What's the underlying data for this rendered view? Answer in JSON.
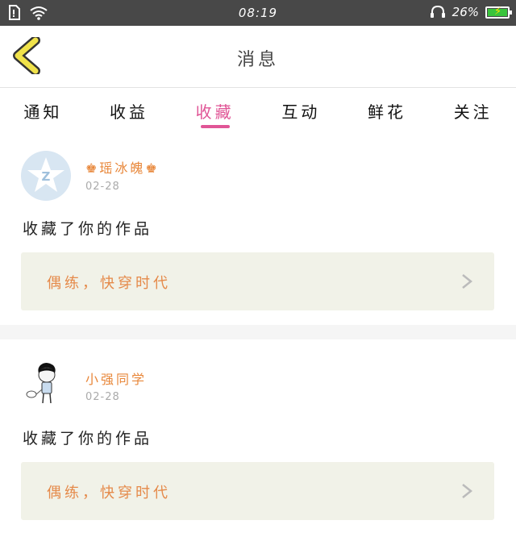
{
  "status_bar": {
    "time": "08:19",
    "battery_percent": "26%",
    "battery_level": 0.26
  },
  "header": {
    "title": "消息",
    "back_icon": "chevron-left-icon"
  },
  "tabs": [
    {
      "label": "通知",
      "active": false
    },
    {
      "label": "收益",
      "active": false
    },
    {
      "label": "收藏",
      "active": true
    },
    {
      "label": "互动",
      "active": false
    },
    {
      "label": "鲜花",
      "active": false
    },
    {
      "label": "关注",
      "active": false
    }
  ],
  "messages": [
    {
      "user": "瑶冰魄",
      "date": "02-28",
      "text": "收藏了你的作品",
      "work": "偶练，快穿时代"
    },
    {
      "user": "小强同学",
      "date": "02-28",
      "text": "收藏了你的作品",
      "work": "偶练，快穿时代"
    }
  ],
  "colors": {
    "accent": "#e05596",
    "name": "#e8873a",
    "work_bg": "#f1f2e8",
    "back_arrow": "#f0e24a"
  }
}
